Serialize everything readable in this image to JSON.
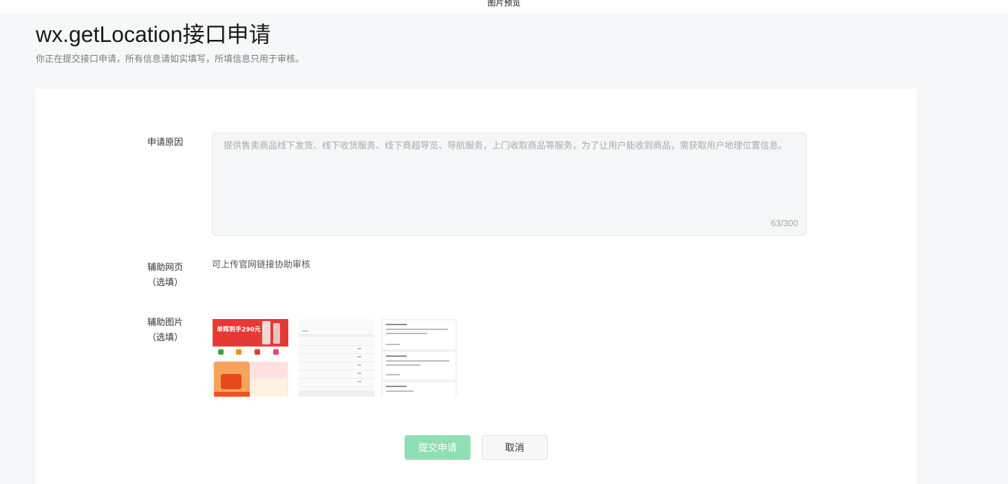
{
  "preview_bar": {
    "title": "图片预览"
  },
  "header": {
    "title": "wx.getLocation接口申请",
    "subtitle": "你正在提交接口申请，所有信息请如实填写，所填信息只用于审核。"
  },
  "form": {
    "reason": {
      "label": "申请原因",
      "value": "提供售卖商品线下发货、线下收货服务、线下商超导览、导航服务，上门收取商品等服务，为了让用户能收到商品，需获取用户地理位置信息。",
      "counter": "63/300"
    },
    "web": {
      "label_line1": "辅助网页",
      "label_line2": "（选填）",
      "hint": "可上传官网链接协助审核"
    },
    "images": {
      "label_line1": "辅助图片",
      "label_line2": "（选填）",
      "thumb1_banner": "单辉到手290元"
    }
  },
  "actions": {
    "submit_label": "提交申请",
    "cancel_label": "取消"
  },
  "colors": {
    "submit_bg": "#8ee0b2",
    "page_bg": "#f6f7f9"
  }
}
